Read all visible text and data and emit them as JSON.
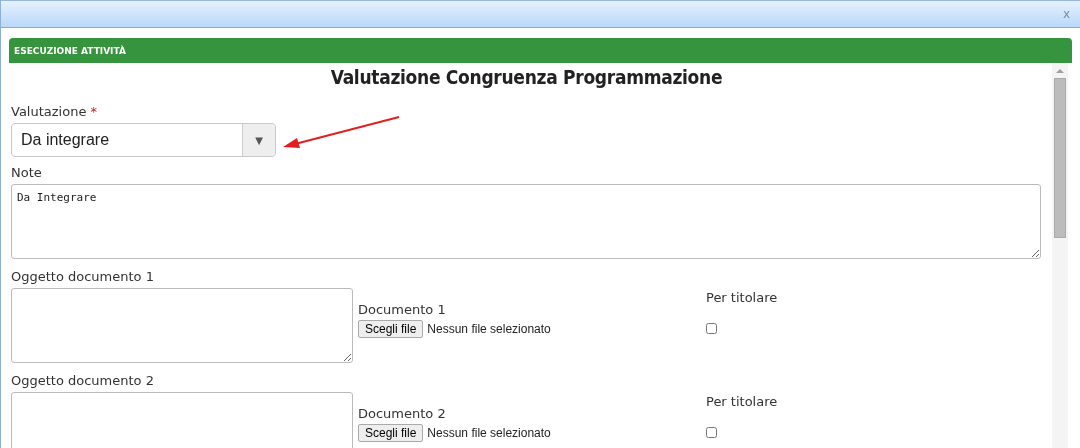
{
  "window": {
    "close": "x"
  },
  "panel": {
    "title": "ESECUZIONE ATTIVITÀ"
  },
  "form": {
    "heading": "Valutazione Congruenza Programmazione",
    "valutazione": {
      "label": "Valutazione",
      "required": "*",
      "value": "Da integrare",
      "caret": "▼"
    },
    "note": {
      "label": "Note",
      "value": "Da Integrare"
    },
    "documents": [
      {
        "object_label": "Oggetto documento 1",
        "doc_label": "Documento 1",
        "button": "Scegli file",
        "status": "Nessun file selezionato",
        "holder_label": "Per titolare",
        "checked": false
      },
      {
        "object_label": "Oggetto documento 2",
        "doc_label": "Documento 2",
        "button": "Scegli file",
        "status": "Nessun file selezionato",
        "holder_label": "Per titolare",
        "checked": false
      }
    ]
  }
}
